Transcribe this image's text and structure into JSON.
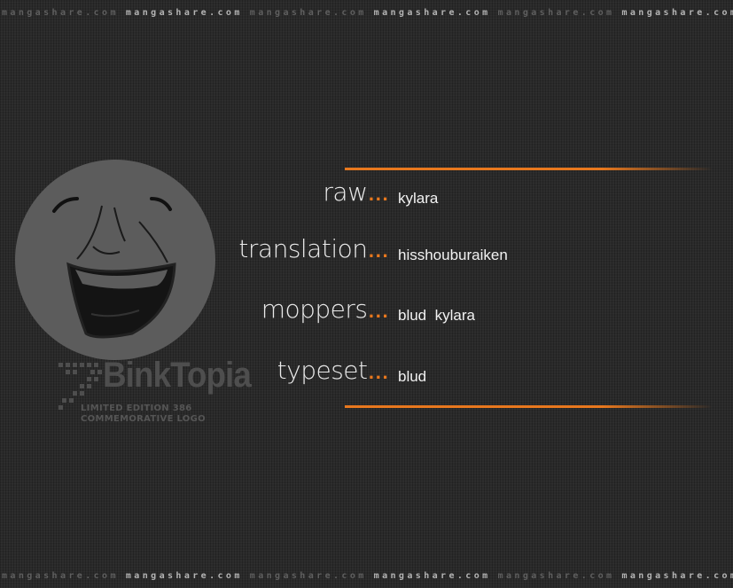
{
  "watermark": {
    "band_text_dim": "mangashare.com",
    "band_text_bright": "mangashare.com"
  },
  "logo": {
    "name": "BinkTopia",
    "line1": "LIMITED EDITION 386",
    "line2": "COMMEMORATIVE LOGO"
  },
  "credits": [
    {
      "label": "raw",
      "ellipsis": "...",
      "value": "kylara"
    },
    {
      "label": "translation",
      "ellipsis": "...",
      "value": "hisshouburaiken"
    },
    {
      "label": "moppers",
      "ellipsis": "...",
      "value": "blud  kylara"
    },
    {
      "label": "typeset",
      "ellipsis": "...",
      "value": "blud"
    }
  ],
  "colors": {
    "background": "#2a2a2a",
    "accent": "#e8781e",
    "label_text": "#ebebeb"
  }
}
